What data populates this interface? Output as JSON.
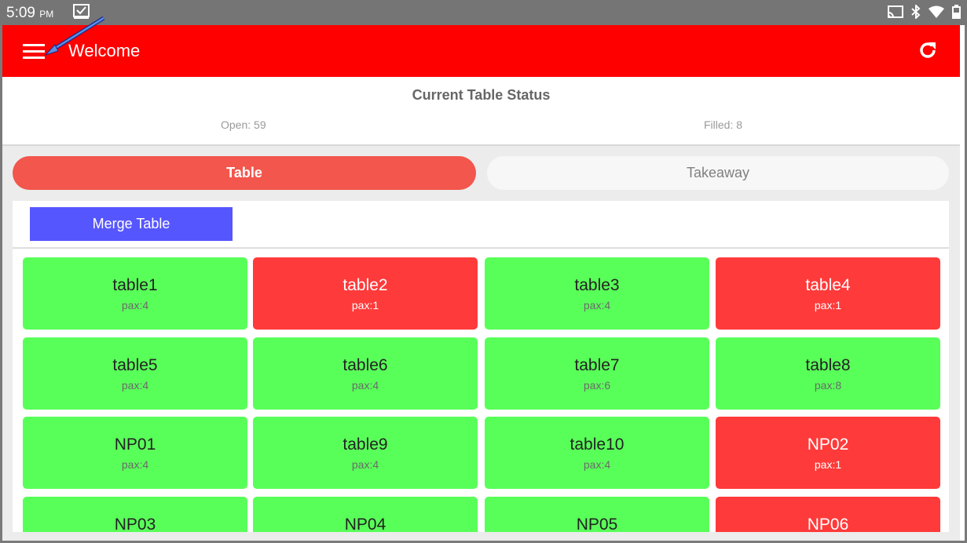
{
  "status_bar": {
    "time": "5:09",
    "ampm": "PM"
  },
  "app_bar": {
    "title": "Welcome"
  },
  "table_status": {
    "title": "Current Table Status",
    "open": "Open: 59",
    "filled": "Filled: 8"
  },
  "tabs": {
    "table": "Table",
    "takeaway": "Takeaway"
  },
  "toolbar": {
    "merge_label": "Merge Table"
  },
  "colors": {
    "header_red": "#ff0000",
    "occupied_red": "#ff3a3a",
    "available_green": "#59ff59",
    "merge_blue": "#5656ff",
    "tab_active": "#f2564c"
  },
  "tables": [
    {
      "name": "table1",
      "pax": "pax:4",
      "status": "open"
    },
    {
      "name": "table2",
      "pax": "pax:1",
      "status": "filled"
    },
    {
      "name": "table3",
      "pax": "pax:4",
      "status": "open"
    },
    {
      "name": "table4",
      "pax": "pax:1",
      "status": "filled"
    },
    {
      "name": "table5",
      "pax": "pax:4",
      "status": "open"
    },
    {
      "name": "table6",
      "pax": "pax:4",
      "status": "open"
    },
    {
      "name": "table7",
      "pax": "pax:6",
      "status": "open"
    },
    {
      "name": "table8",
      "pax": "pax:8",
      "status": "open"
    },
    {
      "name": "NP01",
      "pax": "pax:4",
      "status": "open"
    },
    {
      "name": "table9",
      "pax": "pax:4",
      "status": "open"
    },
    {
      "name": "table10",
      "pax": "pax:4",
      "status": "open"
    },
    {
      "name": "NP02",
      "pax": "pax:1",
      "status": "filled"
    },
    {
      "name": "NP03",
      "pax": "",
      "status": "open"
    },
    {
      "name": "NP04",
      "pax": "",
      "status": "open"
    },
    {
      "name": "NP05",
      "pax": "",
      "status": "open"
    },
    {
      "name": "NP06",
      "pax": "",
      "status": "filled"
    }
  ]
}
